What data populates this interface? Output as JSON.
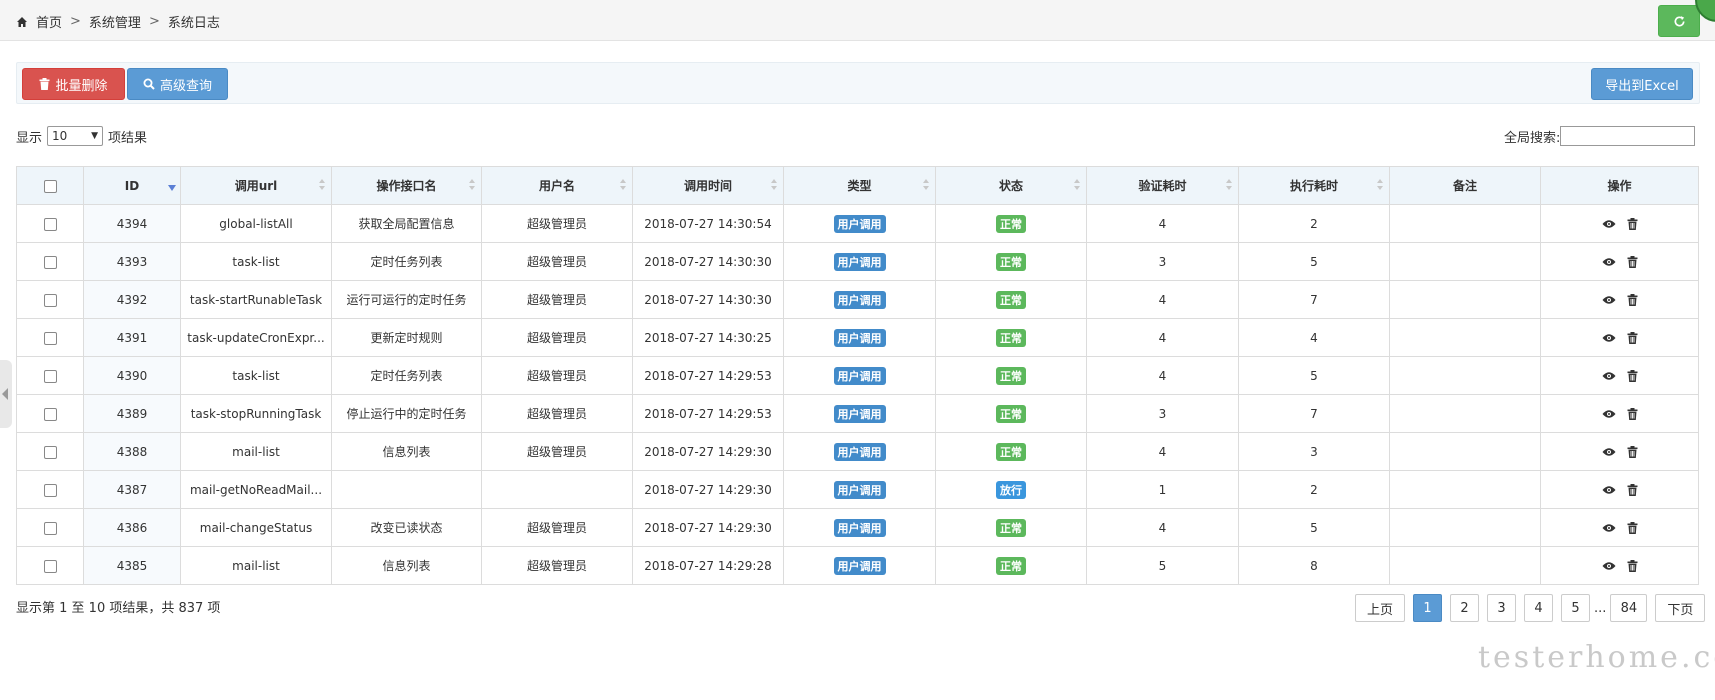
{
  "breadcrumb": {
    "home": "首页",
    "level1": "系统管理",
    "level2": "系统日志",
    "sep": ">"
  },
  "toolbar": {
    "batch_delete": "批量删除",
    "advanced_search": "高级查询",
    "export": "导出到Excel"
  },
  "length": {
    "prefix": "显示",
    "value": "10",
    "suffix": "项结果"
  },
  "search": {
    "label": "全局搜索:",
    "value": ""
  },
  "table": {
    "columns": [
      "ID",
      "调用url",
      "操作接口名",
      "用户名",
      "调用时间",
      "类型",
      "状态",
      "验证耗时",
      "执行耗时",
      "备注",
      "操作"
    ],
    "rows": [
      {
        "id": "4394",
        "url": "global-listAll",
        "name": "获取全局配置信息",
        "user": "超级管理员",
        "time": "2018-07-27 14:30:54",
        "type": "用户调用",
        "status": "正常",
        "auth": "4",
        "exec": "2",
        "note": ""
      },
      {
        "id": "4393",
        "url": "task-list",
        "name": "定时任务列表",
        "user": "超级管理员",
        "time": "2018-07-27 14:30:30",
        "type": "用户调用",
        "status": "正常",
        "auth": "3",
        "exec": "5",
        "note": ""
      },
      {
        "id": "4392",
        "url": "task-startRunableTask",
        "name": "运行可运行的定时任务",
        "user": "超级管理员",
        "time": "2018-07-27 14:30:30",
        "type": "用户调用",
        "status": "正常",
        "auth": "4",
        "exec": "7",
        "note": ""
      },
      {
        "id": "4391",
        "url": "task-updateCronExpr...",
        "name": "更新定时规则",
        "user": "超级管理员",
        "time": "2018-07-27 14:30:25",
        "type": "用户调用",
        "status": "正常",
        "auth": "4",
        "exec": "4",
        "note": ""
      },
      {
        "id": "4390",
        "url": "task-list",
        "name": "定时任务列表",
        "user": "超级管理员",
        "time": "2018-07-27 14:29:53",
        "type": "用户调用",
        "status": "正常",
        "auth": "4",
        "exec": "5",
        "note": ""
      },
      {
        "id": "4389",
        "url": "task-stopRunningTask",
        "name": "停止运行中的定时任务",
        "user": "超级管理员",
        "time": "2018-07-27 14:29:53",
        "type": "用户调用",
        "status": "正常",
        "auth": "3",
        "exec": "7",
        "note": ""
      },
      {
        "id": "4388",
        "url": "mail-list",
        "name": "信息列表",
        "user": "超级管理员",
        "time": "2018-07-27 14:29:30",
        "type": "用户调用",
        "status": "正常",
        "auth": "4",
        "exec": "3",
        "note": ""
      },
      {
        "id": "4387",
        "url": "mail-getNoReadMail...",
        "name": "",
        "user": "",
        "time": "2018-07-27 14:29:30",
        "type": "用户调用",
        "status": "放行",
        "auth": "1",
        "exec": "2",
        "note": ""
      },
      {
        "id": "4386",
        "url": "mail-changeStatus",
        "name": "改变已读状态",
        "user": "超级管理员",
        "time": "2018-07-27 14:29:30",
        "type": "用户调用",
        "status": "正常",
        "auth": "4",
        "exec": "5",
        "note": ""
      },
      {
        "id": "4385",
        "url": "mail-list",
        "name": "信息列表",
        "user": "超级管理员",
        "time": "2018-07-27 14:29:28",
        "type": "用户调用",
        "status": "正常",
        "auth": "5",
        "exec": "8",
        "note": ""
      }
    ]
  },
  "info": "显示第 1 至 10 项结果，共 837 项",
  "pagination": {
    "prev": "上页",
    "pages": [
      "1",
      "2",
      "3",
      "4",
      "5"
    ],
    "ellipsis": "...",
    "last": "84",
    "next": "下页",
    "current": "1"
  },
  "watermark": "testerhome.com",
  "colors": {
    "danger": "#d9534f",
    "primary": "#5b9bd5",
    "success": "#5cb85c",
    "label_blue": "#428bca"
  }
}
